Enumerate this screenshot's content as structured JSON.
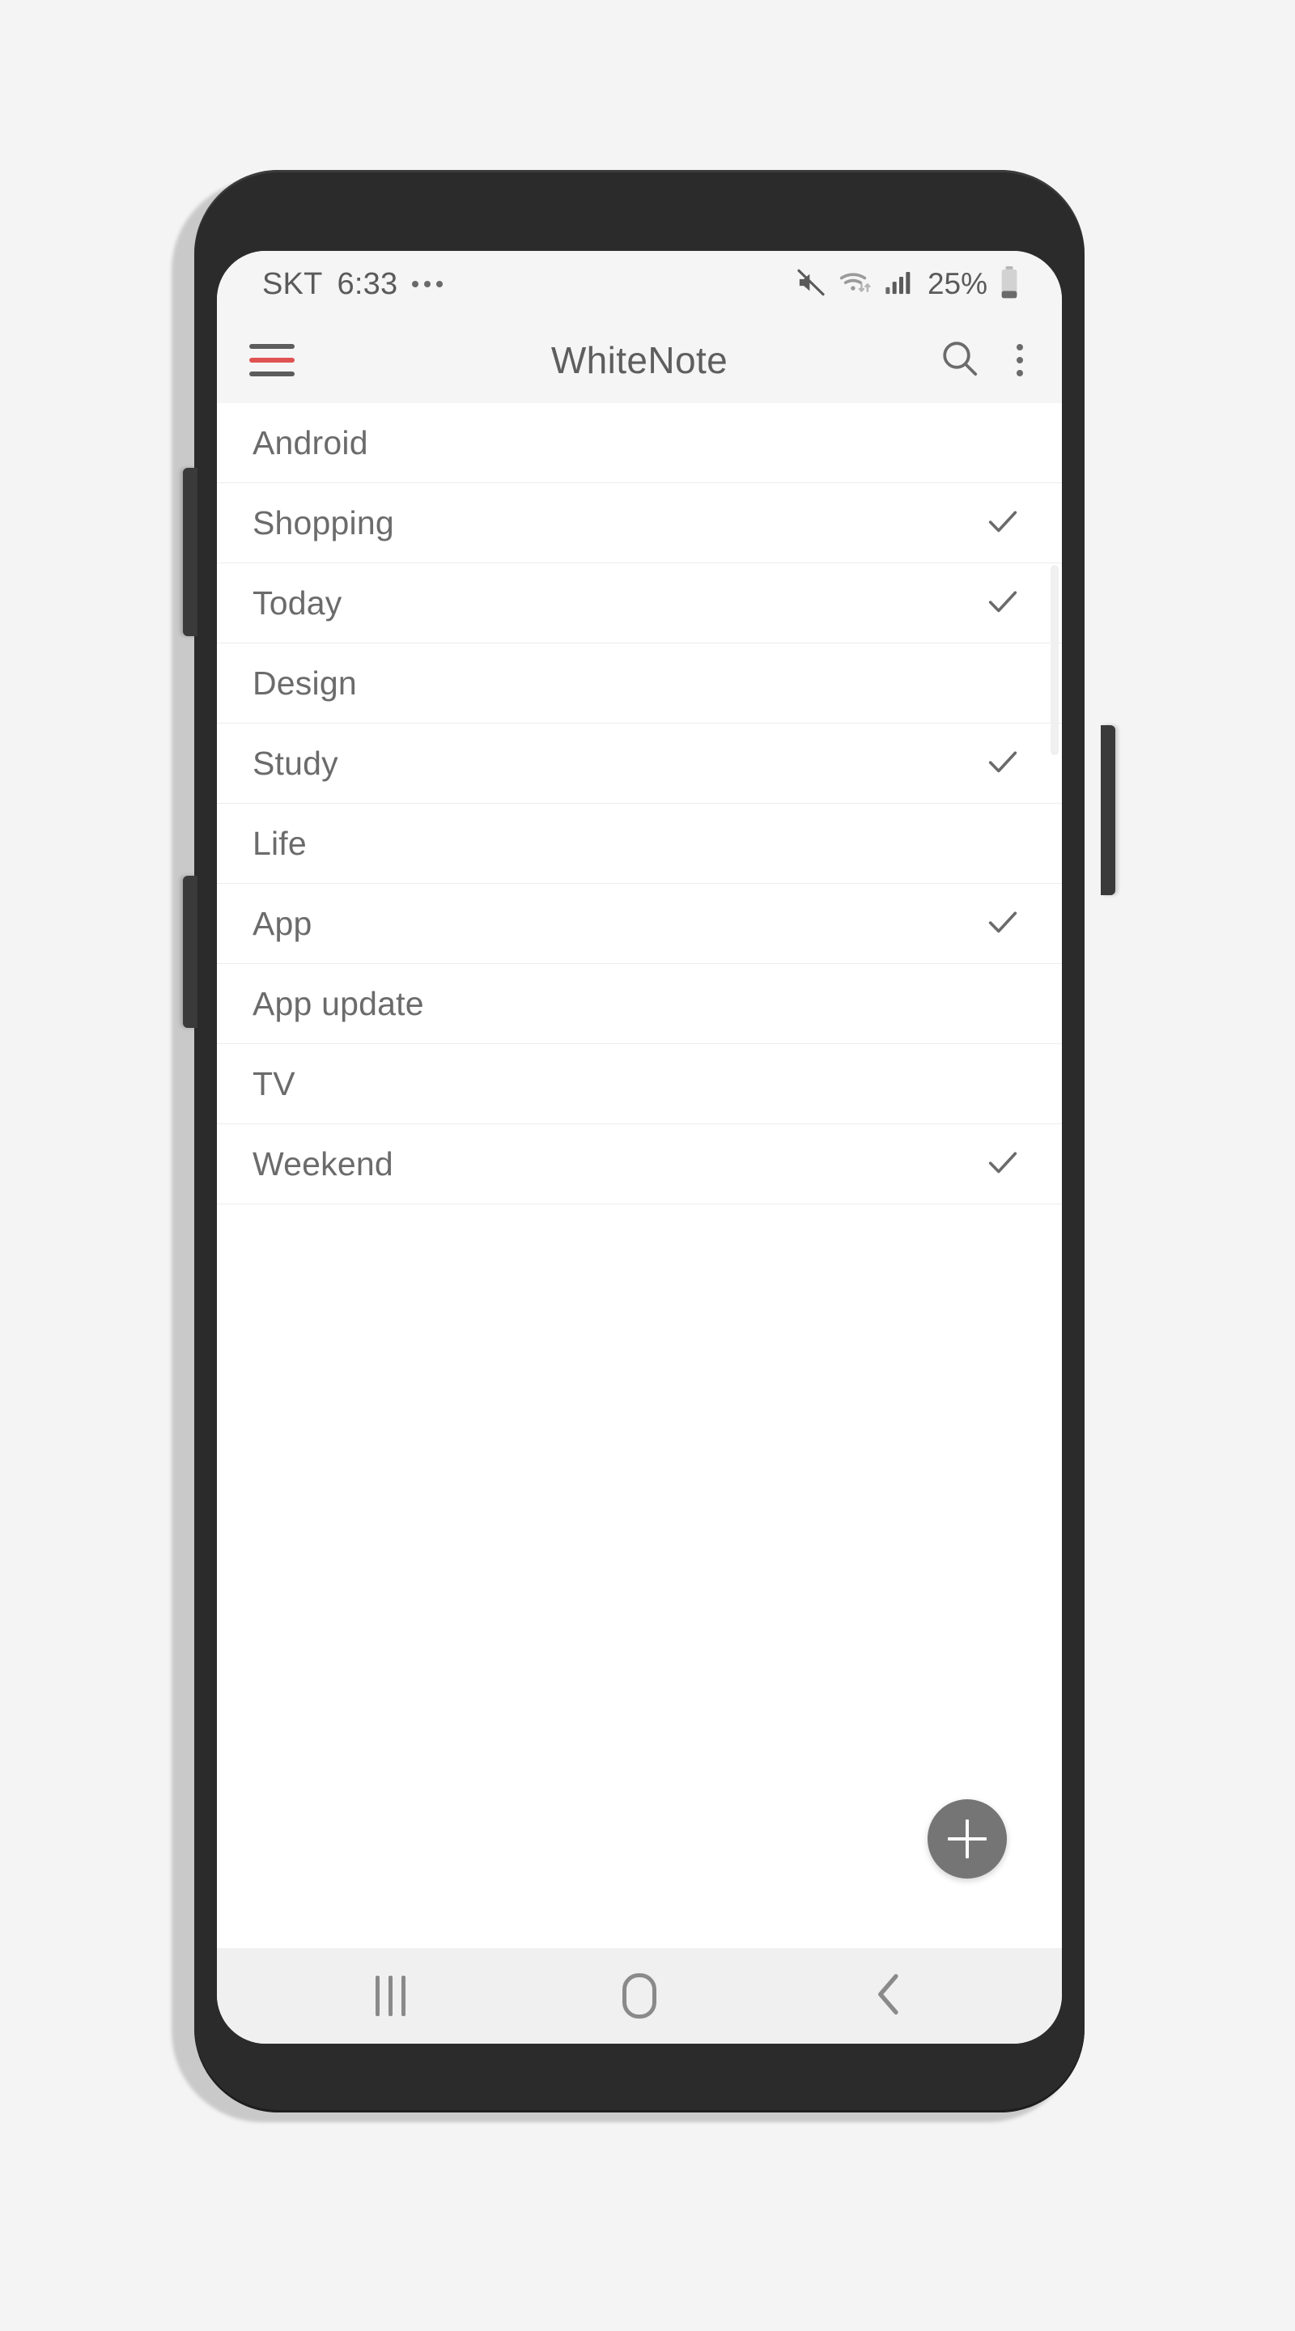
{
  "device": {
    "frame_color": "#2b2b2b",
    "side_buttons": [
      "volume-rocker",
      "bixby-button",
      "power-button"
    ]
  },
  "status_bar": {
    "carrier": "SKT",
    "time": "6:33",
    "notification_dots": "•••",
    "icons": [
      "mute-icon",
      "wifi-icon",
      "signal-icon"
    ],
    "battery_percent": "25%",
    "battery_level": 25,
    "text_color": "#5a5a5a",
    "background": "#f5f5f5"
  },
  "app_bar": {
    "menu_icon": "hamburger-menu-icon",
    "menu_accent_color": "#e05252",
    "title": "WhiteNote",
    "search_icon": "search-icon",
    "overflow_icon": "more-vertical-icon",
    "background": "#f5f5f5",
    "title_color": "#5e5e5e"
  },
  "list": {
    "check_icon": "check-icon",
    "items": [
      {
        "label": "Android",
        "checked": false
      },
      {
        "label": "Shopping",
        "checked": true
      },
      {
        "label": "Today",
        "checked": true
      },
      {
        "label": "Design",
        "checked": false
      },
      {
        "label": "Study",
        "checked": true
      },
      {
        "label": "Life",
        "checked": false
      },
      {
        "label": "App",
        "checked": true
      },
      {
        "label": "App update",
        "checked": false
      },
      {
        "label": "TV",
        "checked": false
      },
      {
        "label": "Weekend",
        "checked": true
      }
    ]
  },
  "fab": {
    "icon": "plus-icon",
    "color": "#757575"
  },
  "nav_bar": {
    "recents_icon": "recents-icon",
    "home_icon": "home-icon",
    "back_icon": "back-icon",
    "background": "#f0f0f0"
  }
}
